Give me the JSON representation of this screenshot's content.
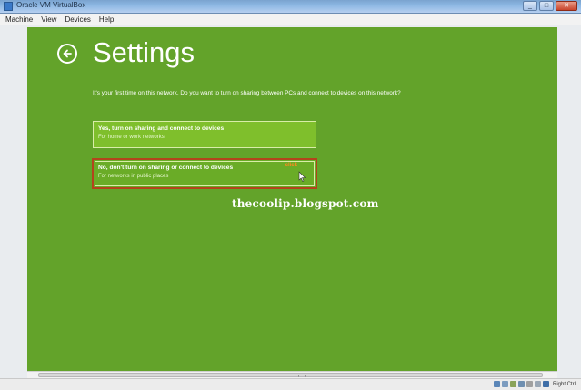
{
  "window": {
    "title": "Oracle VM VirtualBox",
    "buttons": [
      "_",
      "□",
      "✕"
    ]
  },
  "menubar": {
    "items": [
      "Machine",
      "View",
      "Devices",
      "Help"
    ]
  },
  "settings": {
    "title": "Settings",
    "description": "It's your first time on this network. Do you want to turn on sharing between PCs and connect to devices on this network?",
    "options": [
      {
        "title": "Yes, turn on sharing and connect to devices",
        "subtitle": "For home or work networks"
      },
      {
        "title": "No, don't turn on sharing or connect to devices",
        "subtitle": "For networks in public places",
        "badge": "click"
      }
    ]
  },
  "watermark": "thecoolip.blogspot.com",
  "statusbar": {
    "host_key": "Right Ctrl"
  },
  "colors": {
    "background": "#63a32a",
    "highlight": "#b3441c"
  }
}
